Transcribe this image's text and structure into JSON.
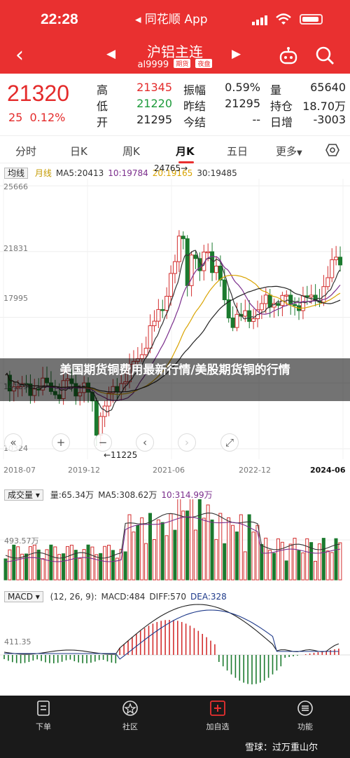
{
  "status": {
    "time": "22:28",
    "back_app": "◂ 同花顺 App"
  },
  "header": {
    "title": "沪铝主连",
    "code": "al9999",
    "tags": [
      "期货",
      "夜盘"
    ]
  },
  "quote": {
    "price": "21320",
    "change": "25",
    "change_pct": "0.12%",
    "cells": [
      {
        "label": "高",
        "value": "21345",
        "color": "#e42b2b"
      },
      {
        "label": "低",
        "value": "21220",
        "color": "#1d9a3a"
      },
      {
        "label": "开",
        "value": "21295",
        "color": "#222"
      },
      {
        "label": "振幅",
        "value": "0.59%",
        "color": "#222"
      },
      {
        "label": "昨结",
        "value": "21295",
        "color": "#222"
      },
      {
        "label": "今结",
        "value": "--",
        "color": "#222"
      },
      {
        "label": "量",
        "value": "65640",
        "color": "#222"
      },
      {
        "label": "持仓",
        "value": "18.70万",
        "color": "#222"
      },
      {
        "label": "日增",
        "value": "-3003",
        "color": "#222"
      }
    ]
  },
  "tabs": [
    "分时",
    "日K",
    "周K",
    "月K",
    "五日",
    "更多"
  ],
  "active_tab": "月K",
  "main_chart": {
    "selector": "均线",
    "legend": [
      {
        "text": "月线",
        "color": "#c49a00"
      },
      {
        "text": "MA5:20413",
        "color": "#333"
      },
      {
        "text": "10:19784",
        "color": "#7b2e8c"
      },
      {
        "text": "20:19165",
        "color": "#d9a300"
      },
      {
        "text": "30:19485",
        "color": "#333"
      }
    ],
    "y_labels": [
      "25666",
      "21831",
      "17995",
      "14159",
      "10324"
    ],
    "x_labels": [
      "2018-07",
      "2019-12",
      "2021-06",
      "2022-12",
      "2024-06"
    ],
    "high_mark": "24765→",
    "low_mark": "←11225"
  },
  "chart_data": {
    "type": "candlestick",
    "ylim": [
      10324,
      25666
    ],
    "categories": [
      "2018-07",
      "2019-12",
      "2021-06",
      "2022-12",
      "2024-06"
    ],
    "high": 24765,
    "low": 11225,
    "last_close": 21320
  },
  "volume_chart": {
    "selector": "成交量",
    "legend": [
      {
        "text": "量:65.34万",
        "color": "#333"
      },
      {
        "text": "MA5:308.62万",
        "color": "#333"
      },
      {
        "text": "10:314.99万",
        "color": "#7b2e8c"
      }
    ],
    "y_label": "493.57万"
  },
  "macd_chart": {
    "selector": "MACD",
    "legend": [
      {
        "text": "(12, 26, 9):",
        "color": "#333"
      },
      {
        "text": "MACD:484",
        "color": "#333"
      },
      {
        "text": "DIFF:570",
        "color": "#333"
      },
      {
        "text": "DEA:328",
        "color": "#1e3a8a"
      }
    ],
    "y_label": "411.35"
  },
  "overlay": {
    "caption": "美国期货铜费用最新行情/美股期货铜的行情"
  },
  "bottom_nav": [
    "下单",
    "社区",
    "加自选",
    "功能"
  ],
  "brand": "雪球：过万重山尔",
  "colors": {
    "accent": "#e93030",
    "up": "#d32f2f",
    "down": "#1b7a2e"
  }
}
